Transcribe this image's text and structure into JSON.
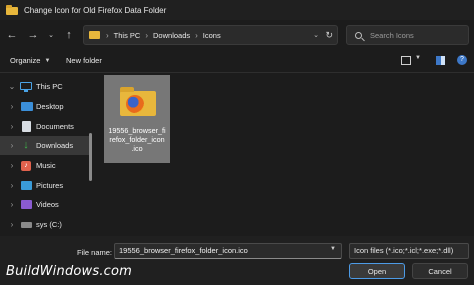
{
  "window": {
    "title": "Change Icon for Old Firefox Data Folder"
  },
  "address": {
    "breadcrumbs": [
      "This PC",
      "Downloads",
      "Icons"
    ]
  },
  "search": {
    "placeholder": "Search Icons"
  },
  "commands": {
    "organize": "Organize",
    "new_folder": "New folder"
  },
  "sidebar": {
    "items": [
      {
        "label": "This PC",
        "icon": "computer-icon",
        "expanded": true
      },
      {
        "label": "Desktop",
        "icon": "desktop-folder-icon"
      },
      {
        "label": "Documents",
        "icon": "documents-icon"
      },
      {
        "label": "Downloads",
        "icon": "download-icon",
        "selected": true
      },
      {
        "label": "Music",
        "icon": "music-icon"
      },
      {
        "label": "Pictures",
        "icon": "pictures-icon"
      },
      {
        "label": "Videos",
        "icon": "videos-icon"
      },
      {
        "label": "sys (C:)",
        "icon": "drive-icon"
      }
    ]
  },
  "files": [
    {
      "name": "19556_browser_firefox_folder_icon.ico",
      "display_lines": [
        "19556_browser_fi",
        "refox_folder_icon",
        ".ico"
      ],
      "selected": true
    }
  ],
  "bottom": {
    "file_name_label": "File name:",
    "file_name_value": "19556_browser_firefox_folder_icon.ico",
    "file_type": "Icon files (*.ico;*.icl;*.exe;*.dll)",
    "open_label": "Open",
    "cancel_label": "Cancel"
  },
  "watermark": "BuildWindows.com",
  "colors": {
    "accent": "#4d9be6",
    "folder": "#e8b73c",
    "background": "#1c1c1c"
  }
}
